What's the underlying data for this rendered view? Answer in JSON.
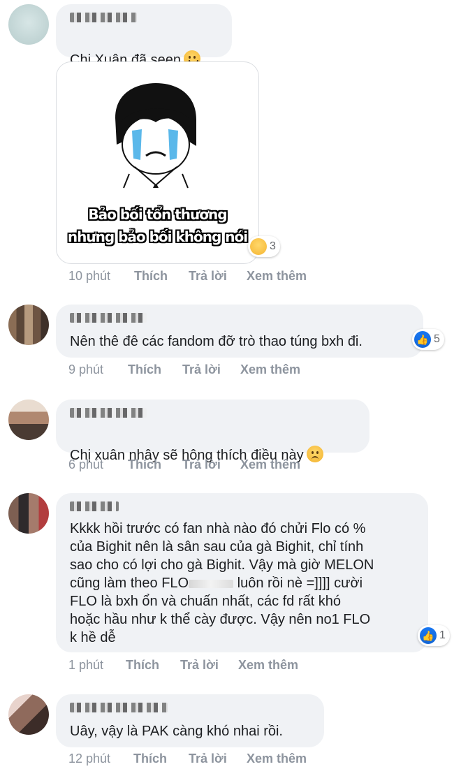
{
  "actions": {
    "like": "Thích",
    "reply": "Trả lời",
    "more": "Xem thêm"
  },
  "comments": [
    {
      "text": "Chị Xuân đã seen",
      "emoji": "slightly-smiling-face-icon",
      "time": "10 phút",
      "sticker": {
        "caption_line1": "Bảo bối tổn thương",
        "caption_line2": "nhưng bảo bối không nói",
        "reaction_icon": "crying-face-icon",
        "reaction_count": "3"
      }
    },
    {
      "text": "Nên thê đê các fandom đỡ trò thao túng bxh đi.",
      "time": "9 phút",
      "reaction_icon": "like-icon",
      "reaction_count": "5"
    },
    {
      "text": "Chị xuân nhây sẽ hông thích điều này",
      "emoji": "confused-face-icon",
      "time": "6 phút"
    },
    {
      "text_before": "Kkkk hồi trước có fan nhà nào đó chửi Flo có %\ncủa Bighit nên là sân sau của gà Bighit, chỉ tính\nsao cho có lợi cho gà Bighit. Vậy mà giờ MELON\ncũng làm theo FLO",
      "text_after": " luôn rồi nè =]]]] cười",
      "text_end": "FLO là bxh ổn và chuấn nhất, các fd rất khó\nhoặc hầu như k thể cày được. Vậy nên no1 FLO\nk hề dễ",
      "time": "1 phút",
      "reaction_icon": "like-icon",
      "reaction_count": "1"
    },
    {
      "text": "Uây, vậy là PAK càng khó nhai rồi.",
      "time": "12 phút"
    }
  ]
}
